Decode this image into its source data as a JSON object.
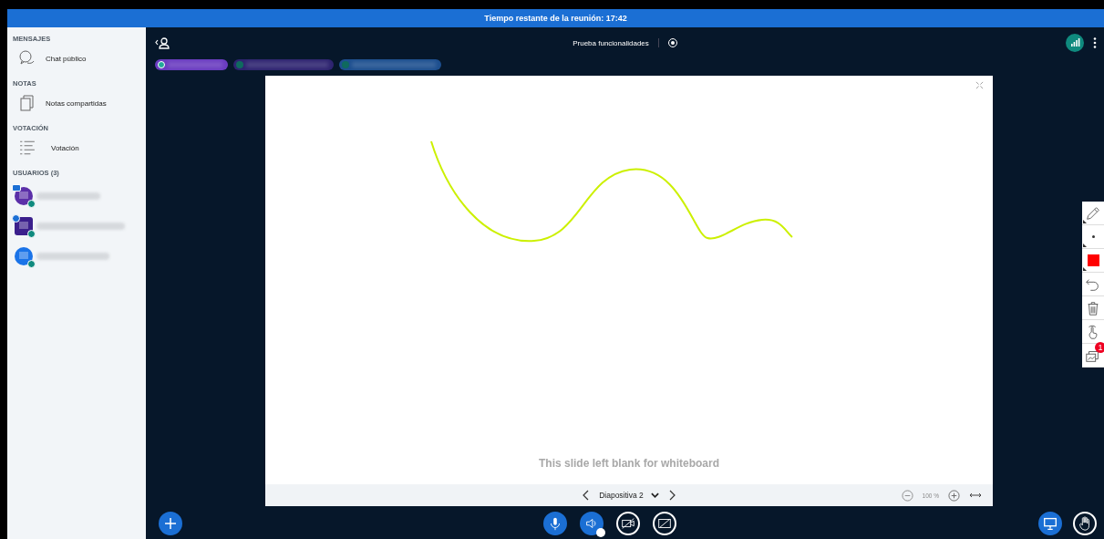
{
  "timer": "Tiempo restante de la reunión: 17:42",
  "sidebar": {
    "sections": [
      {
        "title": "MENSAJES",
        "items": [
          {
            "kind": "chat",
            "label": "Chat público"
          }
        ]
      },
      {
        "title": "NOTAS",
        "items": [
          {
            "kind": "notes",
            "label": "Notas compartidas"
          }
        ]
      },
      {
        "title": "VOTACIÓN",
        "items": [
          {
            "kind": "poll",
            "label": "Votación"
          }
        ]
      }
    ],
    "users_title": "USUARIOS (3)",
    "users": [
      {
        "color": "#5b2fa8",
        "moderator": false,
        "kind": "presenter"
      },
      {
        "color": "#3b1f8c",
        "moderator": true,
        "kind": "whiteboard"
      },
      {
        "color": "#1a73e8",
        "moderator": false,
        "kind": "viewer"
      }
    ]
  },
  "header": {
    "title": "Prueba funcionalidades",
    "recording": false
  },
  "talkers": [
    {
      "color": "#6a3cc0",
      "talking": true
    },
    {
      "color": "#2e2470",
      "talking": false
    },
    {
      "color": "#1d4f8f",
      "talking": false
    }
  ],
  "whiteboard": {
    "blank_text": "This slide left blank for whiteboard",
    "slide": "Diapositiva 2",
    "zoom": "100 %"
  },
  "tools": [
    {
      "kind": "pencil"
    },
    {
      "kind": "thickness"
    },
    {
      "kind": "color",
      "color": "#ff0000"
    },
    {
      "kind": "undo"
    },
    {
      "kind": "clear"
    },
    {
      "kind": "multiuser"
    },
    {
      "kind": "layers",
      "badge": "1"
    }
  ],
  "controls": [
    {
      "kind": "mic",
      "on": true
    },
    {
      "kind": "audio",
      "on": true
    },
    {
      "kind": "video",
      "on": false
    },
    {
      "kind": "screen",
      "on": false
    }
  ],
  "right_controls": [
    {
      "kind": "presentation",
      "on": true
    },
    {
      "kind": "hand",
      "on": false
    }
  ]
}
